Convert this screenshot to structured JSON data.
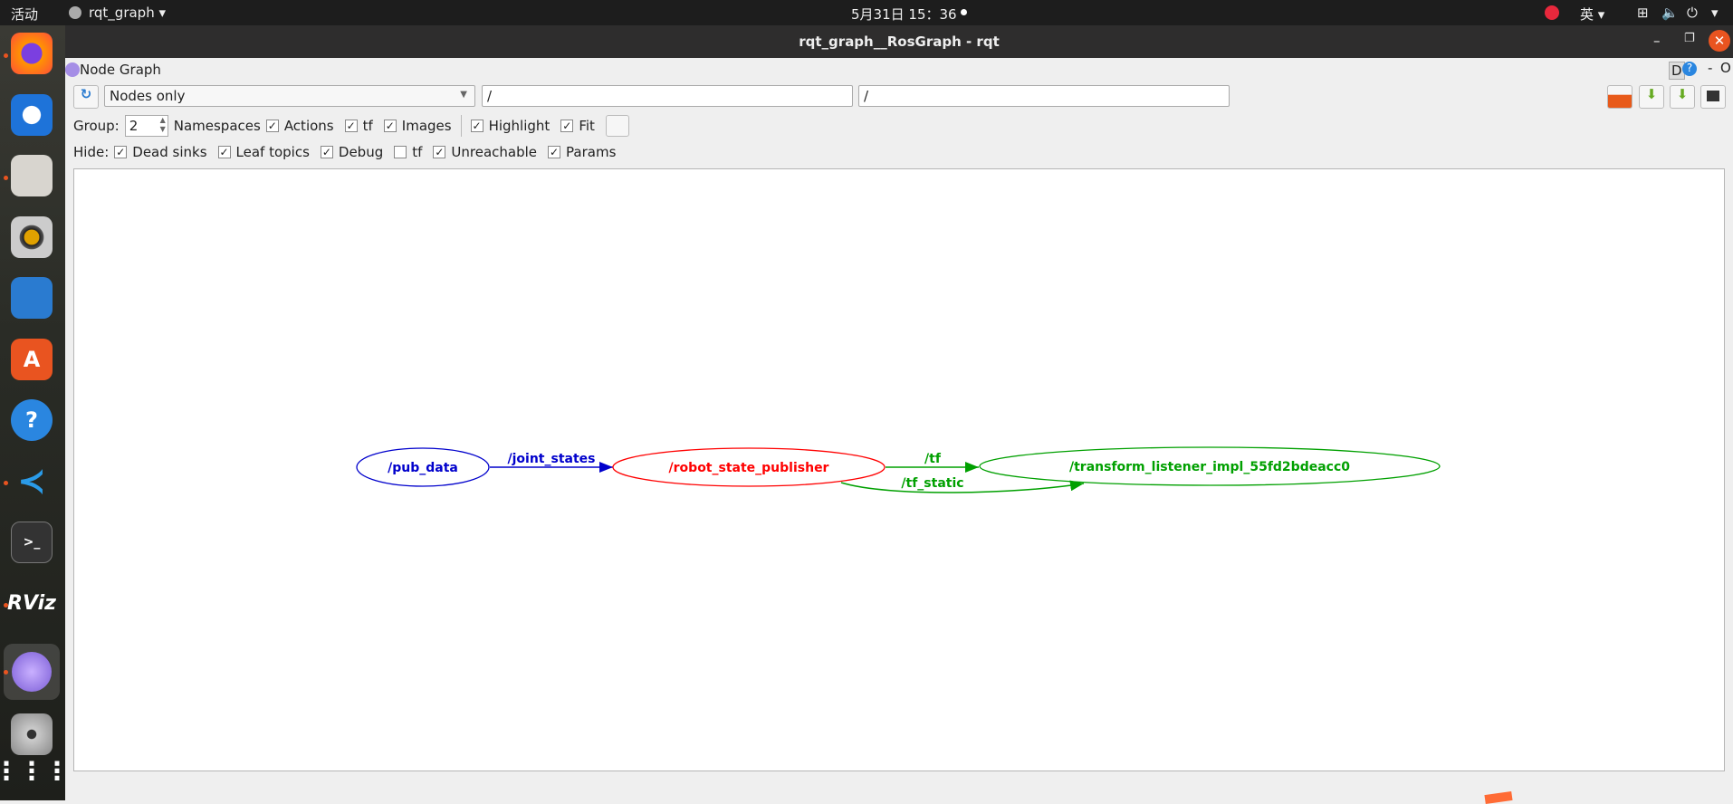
{
  "topbar": {
    "activities": "活动",
    "app": "rqt_graph ▾",
    "clock": "5月31日 15：36",
    "ime": "英 ▾"
  },
  "window": {
    "title": "rqt_graph__RosGraph - rqt"
  },
  "plugin": {
    "title": "Node Graph",
    "d_label": "D",
    "help": "?",
    "minimize": "-",
    "close": "O"
  },
  "toolbar": {
    "mode": "Nodes only",
    "filter1": "/",
    "filter2": "/"
  },
  "options": {
    "group_label": "Group:",
    "group_value": "2",
    "namespaces": "Namespaces",
    "actions": "Actions",
    "actions_checked": true,
    "tf": "tf",
    "tf_checked": true,
    "images": "Images",
    "images_checked": true,
    "highlight": "Highlight",
    "highlight_checked": true,
    "fit": "Fit",
    "fit_checked": true
  },
  "hide": {
    "label": "Hide:",
    "items": [
      {
        "label": "Dead sinks",
        "checked": true
      },
      {
        "label": "Leaf topics",
        "checked": true
      },
      {
        "label": "Debug",
        "checked": true
      },
      {
        "label": "tf",
        "checked": false
      },
      {
        "label": "Unreachable",
        "checked": true
      },
      {
        "label": "Params",
        "checked": true
      }
    ]
  },
  "graph": {
    "nodes": [
      {
        "name": "/pub_data",
        "color": "#0000cc"
      },
      {
        "name": "/robot_state_publisher",
        "color": "#ff0000"
      },
      {
        "name": "/transform_listener_impl_55fd2bdeacc0",
        "color": "#00a000"
      }
    ],
    "edges": [
      {
        "label": "/joint_states",
        "from": "/pub_data",
        "to": "/robot_state_publisher",
        "color": "#0000cc"
      },
      {
        "label": "/tf",
        "from": "/robot_state_publisher",
        "to": "/transform_listener_impl_55fd2bdeacc0",
        "color": "#00a000"
      },
      {
        "label": "/tf_static",
        "from": "/robot_state_publisher",
        "to": "/transform_listener_impl_55fd2bdeacc0",
        "color": "#00a000"
      }
    ]
  },
  "dock": [
    "firefox-icon",
    "thunderbird-icon",
    "files-icon",
    "rhythmbox-icon",
    "writer-icon",
    "app-center-icon",
    "help-icon",
    "vscode-icon",
    "terminal-icon",
    "rviz-icon",
    "rqt-icon",
    "dvd-icon",
    "app-grid-icon"
  ]
}
